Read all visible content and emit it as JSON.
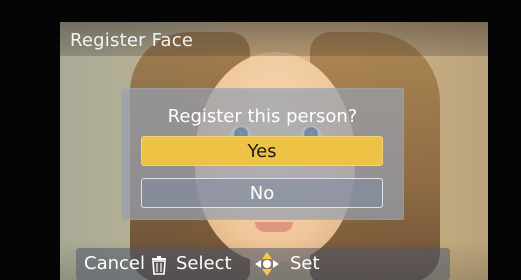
{
  "screen": {
    "title": "Register Face"
  },
  "dialog": {
    "question": "Register this person?",
    "options": [
      {
        "label": "Yes",
        "selected": true
      },
      {
        "label": "No",
        "selected": false
      }
    ]
  },
  "bottom_bar": {
    "cancel_label": "Cancel",
    "select_label": "Select",
    "set_label": "Set",
    "icons": [
      "trash-icon",
      "directional-pad-icon"
    ]
  },
  "colors": {
    "selected_option": "#eec245",
    "dialog_bg": "#96a0af",
    "text_primary": "#ffffff"
  }
}
